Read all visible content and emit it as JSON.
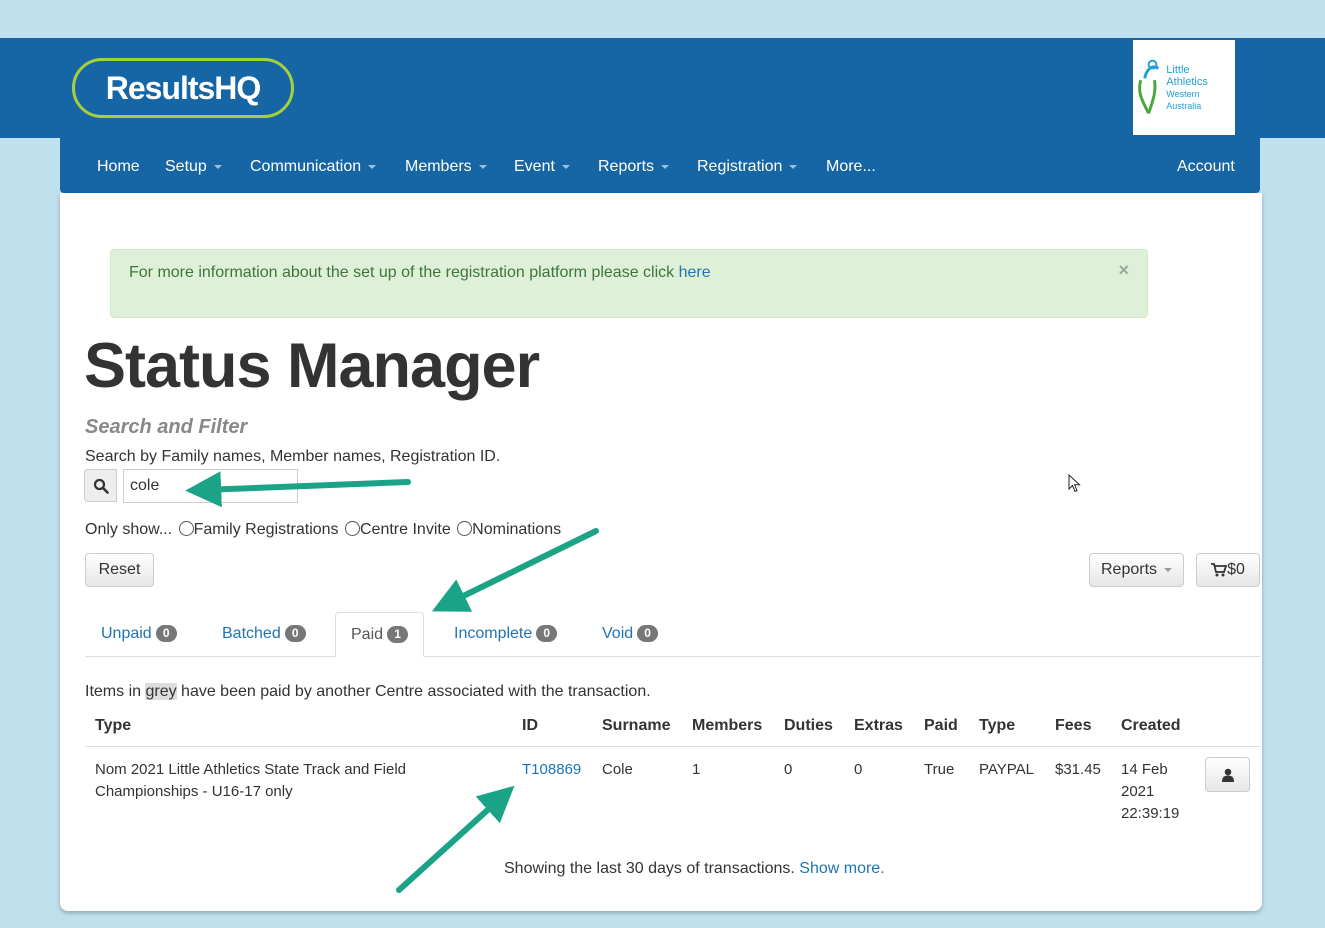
{
  "brand": {
    "logo_text": "ResultsHQ",
    "partner_logo_text": [
      "Little",
      "Athletics",
      "Western Australia"
    ]
  },
  "nav": {
    "items": [
      {
        "label": "Home",
        "dropdown": false
      },
      {
        "label": "Setup",
        "dropdown": true
      },
      {
        "label": "Communication",
        "dropdown": true
      },
      {
        "label": "Members",
        "dropdown": true
      },
      {
        "label": "Event",
        "dropdown": true
      },
      {
        "label": "Reports",
        "dropdown": true
      },
      {
        "label": "Registration",
        "dropdown": true
      },
      {
        "label": "More...",
        "dropdown": false
      }
    ],
    "account": "Account"
  },
  "alert": {
    "message": "For more information about the set up of the registration platform please click ",
    "link": "here",
    "close": "×"
  },
  "page": {
    "title": "Status Manager",
    "subheading": "Search and Filter",
    "search_label": "Search by Family names, Member names, Registration ID.",
    "search_value": "cole"
  },
  "filters": {
    "prefix": "Only show...",
    "options": [
      "Family Registrations",
      "Centre Invite",
      "Nominations"
    ]
  },
  "buttons": {
    "reset": "Reset",
    "reports": "Reports",
    "cart": "$0"
  },
  "tabs": [
    {
      "label": "Unpaid",
      "count": "0",
      "active": false
    },
    {
      "label": "Batched",
      "count": "0",
      "active": false
    },
    {
      "label": "Paid",
      "count": "1",
      "active": true
    },
    {
      "label": "Incomplete",
      "count": "0",
      "active": false
    },
    {
      "label": "Void",
      "count": "0",
      "active": false
    }
  ],
  "note": {
    "before": "Items in ",
    "grey": "grey",
    "after": " have been paid by another Centre associated with the transaction."
  },
  "table": {
    "headers": [
      "Type",
      "ID",
      "Surname",
      "Members",
      "Duties",
      "Extras",
      "Paid",
      "Type",
      "Fees",
      "Created"
    ],
    "rows": [
      {
        "type": "Nom 2021 Little Athletics State Track and Field Championships - U16-17 only",
        "id": "T108869",
        "surname": "Cole",
        "members": "1",
        "duties": "0",
        "extras": "0",
        "paid": "True",
        "payment_type": "PAYPAL",
        "fees": "$31.45",
        "created": "14 Feb 2021 22:39:19"
      }
    ]
  },
  "footer": {
    "text": "Showing the last 30 days of transactions. ",
    "link": "Show more."
  },
  "colors": {
    "header": "#1666a5",
    "page_bg": "#bfe0ec",
    "link": "#1f74b6",
    "alert_bg": "#dff0d8",
    "arrow": "#1aa386"
  },
  "icons": [
    "search-icon",
    "cart-icon",
    "user-icon",
    "close-icon",
    "mouse-cursor-icon"
  ]
}
